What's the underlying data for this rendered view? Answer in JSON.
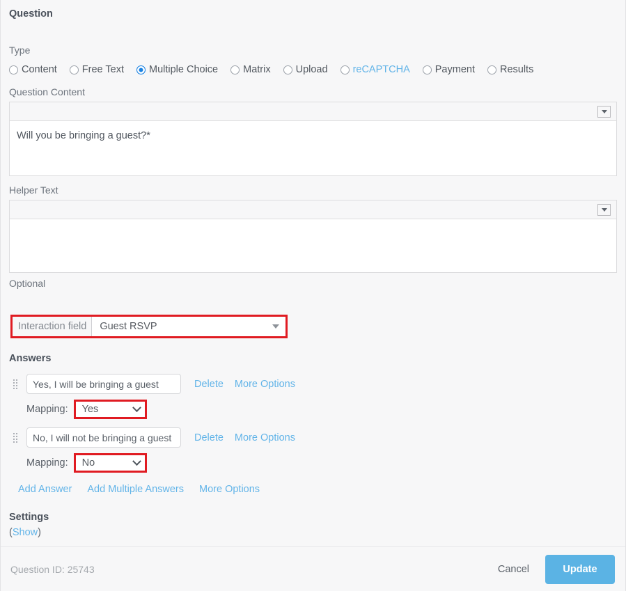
{
  "panel": {
    "title": "Question"
  },
  "type_section": {
    "label": "Type",
    "options": [
      {
        "label": "Content",
        "selected": false,
        "style": "normal"
      },
      {
        "label": "Free Text",
        "selected": false,
        "style": "normal"
      },
      {
        "label": "Multiple Choice",
        "selected": true,
        "style": "normal"
      },
      {
        "label": "Matrix",
        "selected": false,
        "style": "normal"
      },
      {
        "label": "Upload",
        "selected": false,
        "style": "normal"
      },
      {
        "label": "reCAPTCHA",
        "selected": false,
        "style": "link"
      },
      {
        "label": "Payment",
        "selected": false,
        "style": "normal"
      },
      {
        "label": "Results",
        "selected": false,
        "style": "normal"
      }
    ]
  },
  "question_content": {
    "label": "Question Content",
    "value": "Will you be bringing a guest?*",
    "toolbar_icon": "triangle-down-icon"
  },
  "helper_text": {
    "label": "Helper Text",
    "value": "",
    "note": "Optional",
    "toolbar_icon": "triangle-down-icon"
  },
  "interaction_field": {
    "label": "Interaction field",
    "value": "Guest RSVP",
    "highlighted": true,
    "highlight_color": "#e01b22"
  },
  "answers": {
    "title": "Answers",
    "items": [
      {
        "text": "Yes, I will be bringing a guest",
        "delete_label": "Delete",
        "more_options_label": "More Options",
        "mapping_label": "Mapping:",
        "mapping_value": "Yes",
        "mapping_highlighted": true
      },
      {
        "text": "No, I will not be bringing a guest",
        "delete_label": "Delete",
        "more_options_label": "More Options",
        "mapping_label": "Mapping:",
        "mapping_value": "No",
        "mapping_highlighted": true
      }
    ],
    "add_answer_label": "Add Answer",
    "add_multiple_label": "Add Multiple Answers",
    "more_options_label": "More Options"
  },
  "settings": {
    "title": "Settings",
    "show_open": "(",
    "show_label": "Show",
    "show_close": ")"
  },
  "footer": {
    "question_id_label": "Question ID: 25743",
    "cancel_label": "Cancel",
    "update_label": "Update",
    "update_color": "#5bb3e4"
  }
}
